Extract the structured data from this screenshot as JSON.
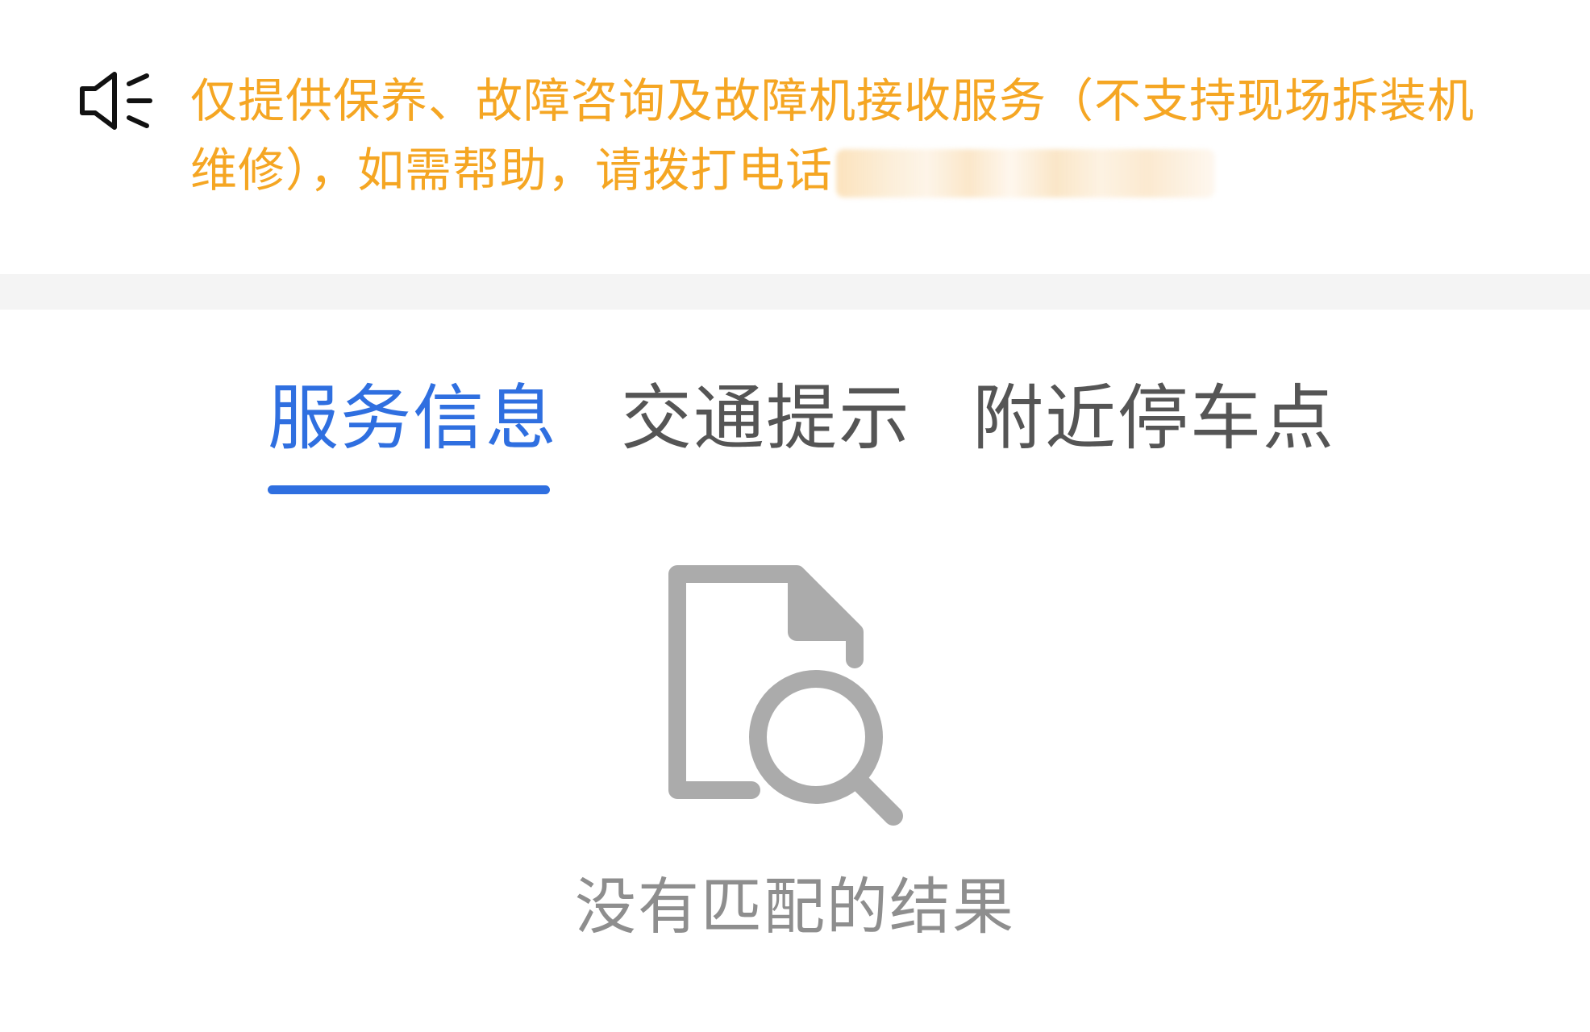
{
  "notice": {
    "icon": "speaker-icon",
    "text": "仅提供保养、故障咨询及故障机接收服务（不支持现场拆装机维修），如需帮助，请拨打电话",
    "text_color": "#F5A623",
    "phone_redacted": true
  },
  "tabs": [
    {
      "label": "服务信息",
      "active": true
    },
    {
      "label": "交通提示",
      "active": false
    },
    {
      "label": "附近停车点",
      "active": false
    }
  ],
  "colors": {
    "accent": "#2F6FE0",
    "tab_inactive": "#555555",
    "divider": "#F4F4F4",
    "empty_icon": "#ABABAB",
    "empty_text": "#8E8E8E"
  },
  "empty_state": {
    "icon": "document-search-icon",
    "message": "没有匹配的结果"
  }
}
